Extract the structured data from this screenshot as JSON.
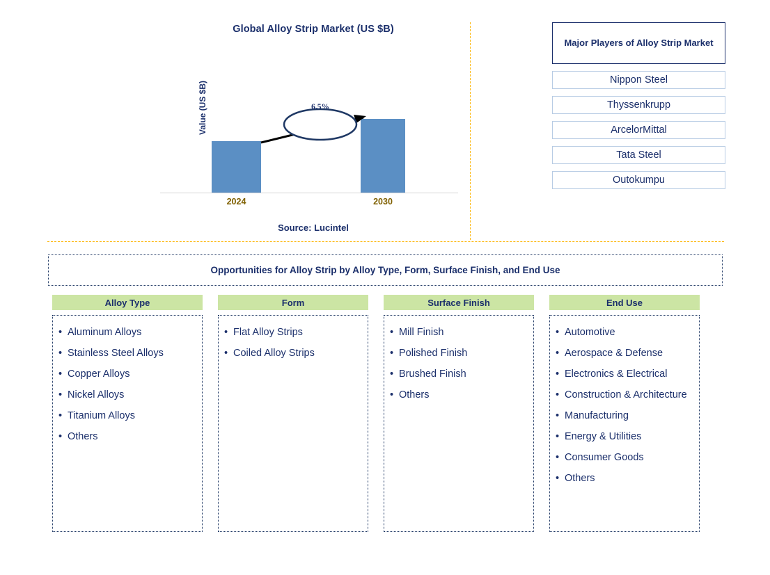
{
  "chart_panel": {
    "title": "Global Alloy Strip Market (US $B)",
    "y_axis_label": "Value (US $B)",
    "growth_label": "6.5%",
    "source": "Source: Lucintel"
  },
  "chart_data": {
    "type": "bar",
    "title": "Global Alloy Strip Market (US $B)",
    "xlabel": "",
    "ylabel": "Value (US $B)",
    "categories": [
      "2024",
      "2030"
    ],
    "values": [
      70,
      100
    ],
    "ylim": [
      0,
      115
    ],
    "grid": false,
    "legend": null,
    "bar_color": "#5b8fc4",
    "annotations": [
      {
        "text": "6.5%",
        "type": "cagr-arrow",
        "from": "2024",
        "to": "2030"
      }
    ],
    "tick_labels": [
      "2024",
      "2030"
    ],
    "source": "Source: Lucintel"
  },
  "players": {
    "title": "Major Players of Alloy Strip Market",
    "items": [
      {
        "name": "Nippon Steel"
      },
      {
        "name": "Thyssenkrupp"
      },
      {
        "name": "ArcelorMittal"
      },
      {
        "name": "Tata Steel"
      },
      {
        "name": "Outokumpu"
      }
    ]
  },
  "opportunities": {
    "banner": "Opportunities for Alloy Strip by Alloy Type, Form, Surface Finish, and End Use",
    "columns": [
      {
        "header": "Alloy Type",
        "items": [
          "Aluminum Alloys",
          "Stainless Steel Alloys",
          "Copper Alloys",
          "Nickel Alloys",
          "Titanium Alloys",
          "Others"
        ]
      },
      {
        "header": "Form",
        "items": [
          "Flat Alloy Strips",
          "Coiled Alloy Strips"
        ]
      },
      {
        "header": "Surface Finish",
        "items": [
          "Mill Finish",
          "Polished Finish",
          "Brushed Finish",
          "Others"
        ]
      },
      {
        "header": "End Use",
        "items": [
          "Automotive",
          "Aerospace & Defense",
          "Electronics & Electrical",
          "Construction & Architecture",
          "Manufacturing",
          "Energy & Utilities",
          "Consumer Goods",
          "Others"
        ]
      }
    ]
  },
  "colors": {
    "navy": "#1b2f6b",
    "bar_blue": "#5b8fc4",
    "header_green": "#cce5a4",
    "divider_orange": "#fdb913",
    "tick_gold": "#7f6000"
  }
}
